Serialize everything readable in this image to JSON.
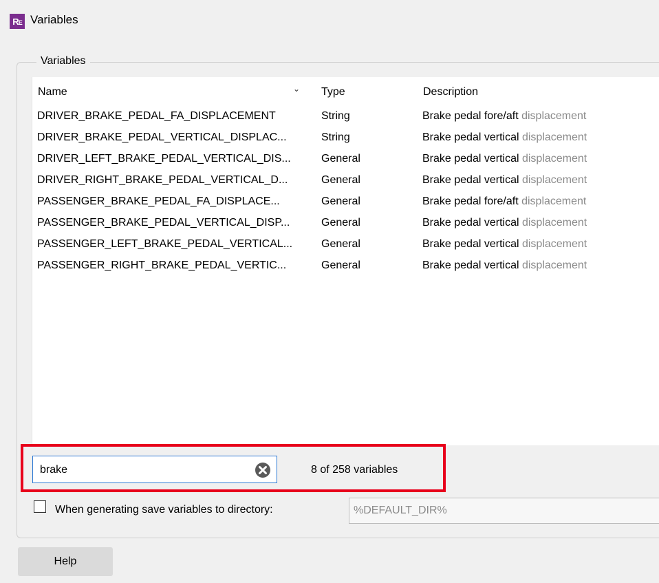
{
  "window": {
    "title": "Variables",
    "icon_text": "R",
    "icon_sub": "E",
    "icon": "re-app-icon"
  },
  "group": {
    "legend": "Variables"
  },
  "table": {
    "columns": {
      "name": "Name",
      "type": "Type",
      "description": "Description"
    },
    "sort_icon": "chevron-down-icon",
    "rows": [
      {
        "name": "DRIVER_BRAKE_PEDAL_FA_DISPLACEMENT",
        "type": "String",
        "desc": "Brake pedal fore/aft",
        "desc_dim": " displacement"
      },
      {
        "name": "DRIVER_BRAKE_PEDAL_VERTICAL_DISPLAC...",
        "type": "String",
        "desc": "Brake pedal vertical",
        "desc_dim": " displacement"
      },
      {
        "name": "DRIVER_LEFT_BRAKE_PEDAL_VERTICAL_DIS...",
        "type": "General",
        "desc": "Brake pedal vertical",
        "desc_dim": " displacement"
      },
      {
        "name": "DRIVER_RIGHT_BRAKE_PEDAL_VERTICAL_D...",
        "type": "General",
        "desc": "Brake pedal vertical",
        "desc_dim": " displacement"
      },
      {
        "name": "PASSENGER_BRAKE_PEDAL_FA_DISPLACE...",
        "type": "General",
        "desc": "Brake pedal fore/aft",
        "desc_dim": " displacement"
      },
      {
        "name": "PASSENGER_BRAKE_PEDAL_VERTICAL_DISP...",
        "type": "General",
        "desc": "Brake pedal vertical",
        "desc_dim": " displacement"
      },
      {
        "name": "PASSENGER_LEFT_BRAKE_PEDAL_VERTICAL...",
        "type": "General",
        "desc": "Brake pedal vertical",
        "desc_dim": " displacement"
      },
      {
        "name": "PASSENGER_RIGHT_BRAKE_PEDAL_VERTIC...",
        "type": "General",
        "desc": "Brake pedal vertical",
        "desc_dim": " displacement"
      }
    ]
  },
  "search": {
    "value": "brake",
    "clear_icon": "clear-circle-icon",
    "count": "8 of 258 variables"
  },
  "save_option": {
    "checked": false,
    "label": "When generating save variables to directory:",
    "directory_placeholder": "%DEFAULT_DIR%"
  },
  "buttons": {
    "help": "Help"
  },
  "colors": {
    "highlight": "#e8001c",
    "app_icon": "#7b2d8e",
    "focus_border": "#2b78d3"
  }
}
